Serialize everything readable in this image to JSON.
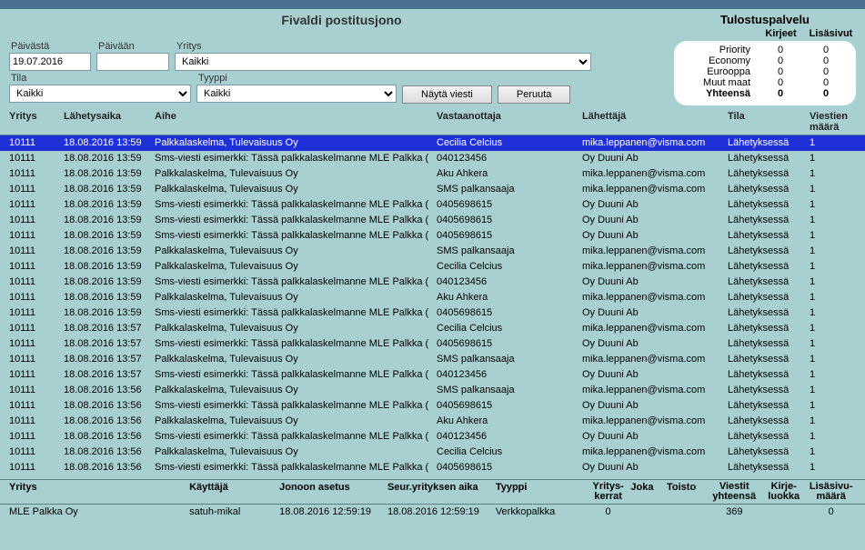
{
  "header": {
    "title": "Fivaldi postitusjono",
    "tulostus_title": "Tulostuspalvelu",
    "col_kirjeet": "Kirjeet",
    "col_lisasivut": "Lisäsivut"
  },
  "filters": {
    "paivasta_label": "Päivästä",
    "paivasta_value": "19.07.2016",
    "paivaan_label": "Päivään",
    "paivaan_value": "",
    "yritys_label": "Yritys",
    "yritys_value": "Kaikki",
    "tila_label": "Tila",
    "tila_value": "Kaikki",
    "tyyppi_label": "Tyyppi",
    "tyyppi_value": "Kaikki",
    "btn_nayta": "Näytä viesti",
    "btn_peruuta": "Peruuta"
  },
  "tulostus": {
    "rows": [
      {
        "lbl": "Priority",
        "v1": "0",
        "v2": "0"
      },
      {
        "lbl": "Economy",
        "v1": "0",
        "v2": "0"
      },
      {
        "lbl": "Eurooppa",
        "v1": "0",
        "v2": "0"
      },
      {
        "lbl": "Muut maat",
        "v1": "0",
        "v2": "0"
      },
      {
        "lbl": "Yhteensä",
        "v1": "0",
        "v2": "0"
      }
    ]
  },
  "grid": {
    "headers": {
      "yritys": "Yritys",
      "laika": "Lähetysaika",
      "aihe": "Aihe",
      "vast": "Vastaanottaja",
      "lahet": "Lähettäjä",
      "tila": "Tila",
      "maara": "Viestien määrä"
    },
    "rows": [
      {
        "yritys": "10111",
        "laika": "18.08.2016 13:59",
        "aihe": "Palkkalaskelma, Tulevaisuus Oy",
        "vast": "Cecilia Celcius",
        "lahet": "mika.leppanen@visma.com",
        "tila": "Lähetyksessä",
        "maara": "1",
        "selected": true
      },
      {
        "yritys": "10111",
        "laika": "18.08.2016 13:59",
        "aihe": "Sms-viesti esimerkki: Tässä palkkalaskelmanne MLE Palkka (",
        "vast": "040123456",
        "lahet": "Oy Duuni Ab",
        "tila": "Lähetyksessä",
        "maara": "1"
      },
      {
        "yritys": "10111",
        "laika": "18.08.2016 13:59",
        "aihe": "Palkkalaskelma, Tulevaisuus Oy",
        "vast": "Aku Ahkera",
        "lahet": "mika.leppanen@visma.com",
        "tila": "Lähetyksessä",
        "maara": "1"
      },
      {
        "yritys": "10111",
        "laika": "18.08.2016 13:59",
        "aihe": "Palkkalaskelma, Tulevaisuus Oy",
        "vast": "SMS palkansaaja",
        "lahet": "mika.leppanen@visma.com",
        "tila": "Lähetyksessä",
        "maara": "1"
      },
      {
        "yritys": "10111",
        "laika": "18.08.2016 13:59",
        "aihe": "Sms-viesti esimerkki: Tässä palkkalaskelmanne MLE Palkka (",
        "vast": "0405698615",
        "lahet": "Oy Duuni Ab",
        "tila": "Lähetyksessä",
        "maara": "1"
      },
      {
        "yritys": "10111",
        "laika": "18.08.2016 13:59",
        "aihe": "Sms-viesti esimerkki: Tässä palkkalaskelmanne MLE Palkka (",
        "vast": "0405698615",
        "lahet": "Oy Duuni Ab",
        "tila": "Lähetyksessä",
        "maara": "1"
      },
      {
        "yritys": "10111",
        "laika": "18.08.2016 13:59",
        "aihe": "Sms-viesti esimerkki: Tässä palkkalaskelmanne MLE Palkka (",
        "vast": "0405698615",
        "lahet": "Oy Duuni Ab",
        "tila": "Lähetyksessä",
        "maara": "1"
      },
      {
        "yritys": "10111",
        "laika": "18.08.2016 13:59",
        "aihe": "Palkkalaskelma, Tulevaisuus Oy",
        "vast": "SMS palkansaaja",
        "lahet": "mika.leppanen@visma.com",
        "tila": "Lähetyksessä",
        "maara": "1"
      },
      {
        "yritys": "10111",
        "laika": "18.08.2016 13:59",
        "aihe": "Palkkalaskelma, Tulevaisuus Oy",
        "vast": "Cecilia Celcius",
        "lahet": "mika.leppanen@visma.com",
        "tila": "Lähetyksessä",
        "maara": "1"
      },
      {
        "yritys": "10111",
        "laika": "18.08.2016 13:59",
        "aihe": "Sms-viesti esimerkki: Tässä palkkalaskelmanne MLE Palkka (",
        "vast": "040123456",
        "lahet": "Oy Duuni Ab",
        "tila": "Lähetyksessä",
        "maara": "1"
      },
      {
        "yritys": "10111",
        "laika": "18.08.2016 13:59",
        "aihe": "Palkkalaskelma, Tulevaisuus Oy",
        "vast": "Aku Ahkera",
        "lahet": "mika.leppanen@visma.com",
        "tila": "Lähetyksessä",
        "maara": "1"
      },
      {
        "yritys": "10111",
        "laika": "18.08.2016 13:59",
        "aihe": "Sms-viesti esimerkki: Tässä palkkalaskelmanne MLE Palkka (",
        "vast": "0405698615",
        "lahet": "Oy Duuni Ab",
        "tila": "Lähetyksessä",
        "maara": "1"
      },
      {
        "yritys": "10111",
        "laika": "18.08.2016 13:57",
        "aihe": "Palkkalaskelma, Tulevaisuus Oy",
        "vast": "Cecilia Celcius",
        "lahet": "mika.leppanen@visma.com",
        "tila": "Lähetyksessä",
        "maara": "1"
      },
      {
        "yritys": "10111",
        "laika": "18.08.2016 13:57",
        "aihe": "Sms-viesti esimerkki: Tässä palkkalaskelmanne MLE Palkka (",
        "vast": "0405698615",
        "lahet": "Oy Duuni Ab",
        "tila": "Lähetyksessä",
        "maara": "1"
      },
      {
        "yritys": "10111",
        "laika": "18.08.2016 13:57",
        "aihe": "Palkkalaskelma, Tulevaisuus Oy",
        "vast": "SMS palkansaaja",
        "lahet": "mika.leppanen@visma.com",
        "tila": "Lähetyksessä",
        "maara": "1"
      },
      {
        "yritys": "10111",
        "laika": "18.08.2016 13:57",
        "aihe": "Sms-viesti esimerkki: Tässä palkkalaskelmanne MLE Palkka (",
        "vast": "040123456",
        "lahet": "Oy Duuni Ab",
        "tila": "Lähetyksessä",
        "maara": "1"
      },
      {
        "yritys": "10111",
        "laika": "18.08.2016 13:56",
        "aihe": "Palkkalaskelma, Tulevaisuus Oy",
        "vast": "SMS palkansaaja",
        "lahet": "mika.leppanen@visma.com",
        "tila": "Lähetyksessä",
        "maara": "1"
      },
      {
        "yritys": "10111",
        "laika": "18.08.2016 13:56",
        "aihe": "Sms-viesti esimerkki: Tässä palkkalaskelmanne MLE Palkka (",
        "vast": "0405698615",
        "lahet": "Oy Duuni Ab",
        "tila": "Lähetyksessä",
        "maara": "1"
      },
      {
        "yritys": "10111",
        "laika": "18.08.2016 13:56",
        "aihe": "Palkkalaskelma, Tulevaisuus Oy",
        "vast": "Aku Ahkera",
        "lahet": "mika.leppanen@visma.com",
        "tila": "Lähetyksessä",
        "maara": "1"
      },
      {
        "yritys": "10111",
        "laika": "18.08.2016 13:56",
        "aihe": "Sms-viesti esimerkki: Tässä palkkalaskelmanne MLE Palkka (",
        "vast": "040123456",
        "lahet": "Oy Duuni Ab",
        "tila": "Lähetyksessä",
        "maara": "1"
      },
      {
        "yritys": "10111",
        "laika": "18.08.2016 13:56",
        "aihe": "Palkkalaskelma, Tulevaisuus Oy",
        "vast": "Cecilia Celcius",
        "lahet": "mika.leppanen@visma.com",
        "tila": "Lähetyksessä",
        "maara": "1"
      },
      {
        "yritys": "10111",
        "laika": "18.08.2016 13:56",
        "aihe": "Sms-viesti esimerkki: Tässä palkkalaskelmanne MLE Palkka (",
        "vast": "0405698615",
        "lahet": "Oy Duuni Ab",
        "tila": "Lähetyksessä",
        "maara": "1"
      }
    ]
  },
  "summary": {
    "headers": {
      "yritys": "Yritys",
      "kayttaja": "Käyttäjä",
      "jonoon": "Jonoon asetus",
      "seur": "Seur.yrityksen aika",
      "tyyppi": "Tyyppi",
      "yk1": "Yritys-",
      "yk2": "kerrat",
      "joka": "Joka",
      "toisto": "Toisto",
      "vy1": "Viestit",
      "vy2": "yhteensä",
      "kl1": "Kirje-",
      "kl2": "luokka",
      "lm1": "Lisäsivu-",
      "lm2": "määrä"
    },
    "row": {
      "yritys": "MLE Palkka Oy",
      "kayttaja": "satuh-mikal",
      "jonoon": "18.08.2016 12:59:19",
      "seur": "18.08.2016 12:59:19",
      "tyyppi": "Verkkopalkka",
      "yk": "0",
      "joka": "",
      "toisto": "",
      "vy": "369",
      "kl": "",
      "lm": "0"
    }
  }
}
